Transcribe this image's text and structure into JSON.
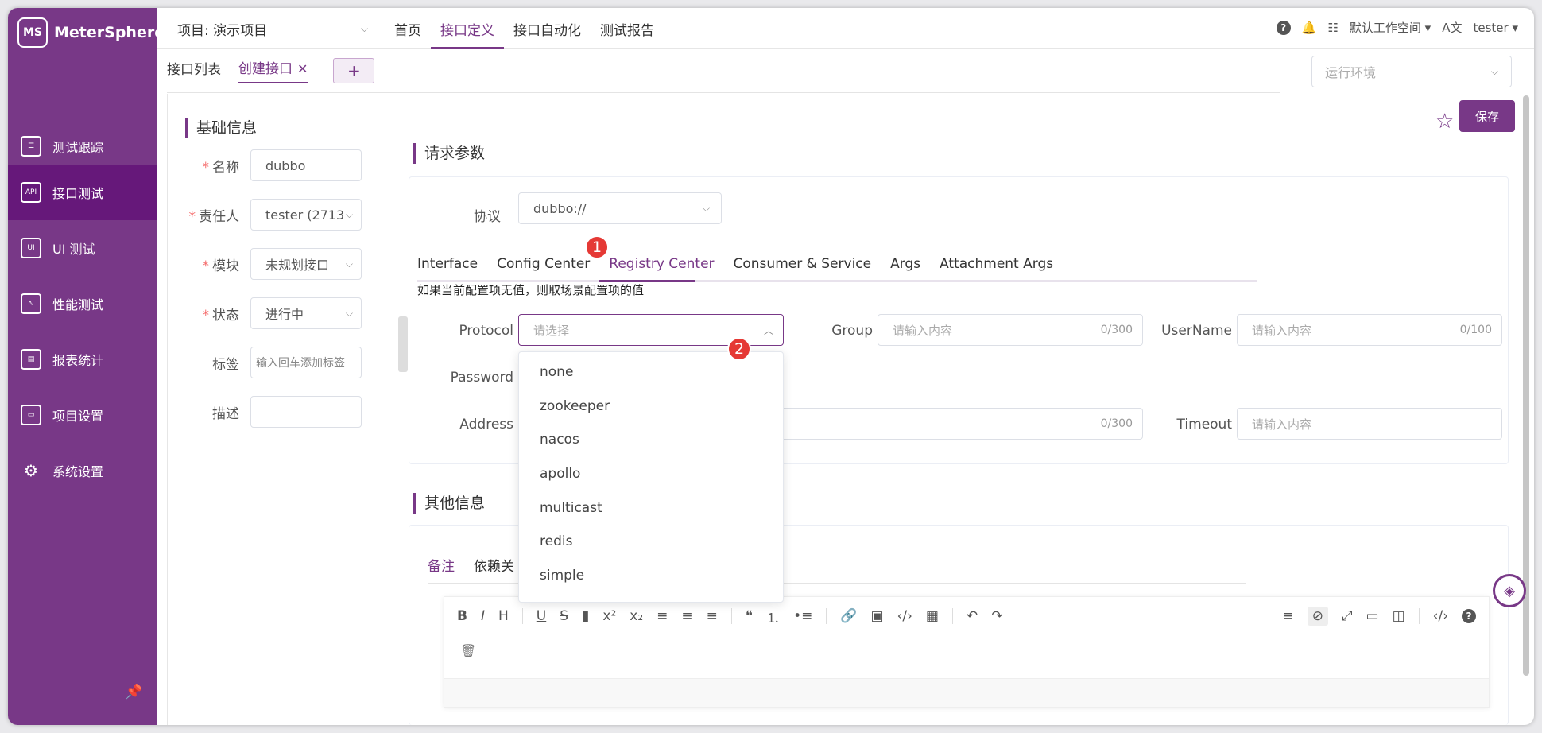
{
  "brand": {
    "name": "MeterSphere",
    "mark": "MS"
  },
  "sidebar": {
    "items": [
      {
        "label": "测试跟踪",
        "icon": "clipboard-icon",
        "active": false
      },
      {
        "label": "接口测试",
        "icon": "api-icon",
        "active": true
      },
      {
        "label": "UI 测试",
        "icon": "ui-icon",
        "active": false
      },
      {
        "label": "性能测试",
        "icon": "chart-icon",
        "active": false
      },
      {
        "label": "报表统计",
        "icon": "report-icon",
        "active": false
      },
      {
        "label": "项目设置",
        "icon": "folder-icon",
        "active": false
      },
      {
        "label": "系统设置",
        "icon": "gear-icon",
        "active": false
      }
    ]
  },
  "topbar": {
    "project": "项目: 演示项目",
    "nav": [
      "首页",
      "接口定义",
      "接口自动化",
      "测试报告"
    ],
    "active_nav": "接口定义",
    "workspace": "默认工作空间",
    "user": "tester"
  },
  "subtabs": {
    "list": "接口列表",
    "create": "创建接口",
    "add": "+"
  },
  "env": {
    "placeholder": "运行环境"
  },
  "basic": {
    "title": "基础信息",
    "name_label": "名称",
    "name_value": "dubbo",
    "owner_label": "责任人",
    "owner_value": "tester (2713",
    "module_label": "模块",
    "module_value": "未规划接口",
    "status_label": "状态",
    "status_value": "进行中",
    "tag_label": "标签",
    "tag_placeholder": "输入回车添加标签",
    "desc_label": "描述"
  },
  "actions": {
    "save": "保存"
  },
  "request": {
    "title": "请求参数",
    "protocol_label": "协议",
    "protocol_value": "dubbo://",
    "tabs": [
      "Interface",
      "Config Center",
      "Registry Center",
      "Consumer & Service",
      "Args",
      "Attachment Args"
    ],
    "active_tab": "Registry Center",
    "hint": "如果当前配置项无值，则取场景配置项的值",
    "protocol_field": {
      "label": "Protocol",
      "placeholder": "请选择"
    },
    "group_field": {
      "label": "Group",
      "placeholder": "请输入内容",
      "count": "0/300"
    },
    "username_field": {
      "label": "UserName",
      "placeholder": "请输入内容",
      "count": "0/100"
    },
    "password_field": {
      "label": "Password"
    },
    "address_field": {
      "label": "Address",
      "count": "0/300"
    },
    "timeout_field": {
      "label": "Timeout",
      "placeholder": "请输入内容"
    },
    "options": [
      "none",
      "zookeeper",
      "nacos",
      "apollo",
      "multicast",
      "redis",
      "simple"
    ]
  },
  "badges": {
    "one": "1",
    "two": "2"
  },
  "other": {
    "title": "其他信息",
    "tabs": [
      "备注",
      "依赖关"
    ]
  },
  "colors": {
    "brand": "#783887",
    "active_nav": "#66187a",
    "badge": "#e53935"
  }
}
